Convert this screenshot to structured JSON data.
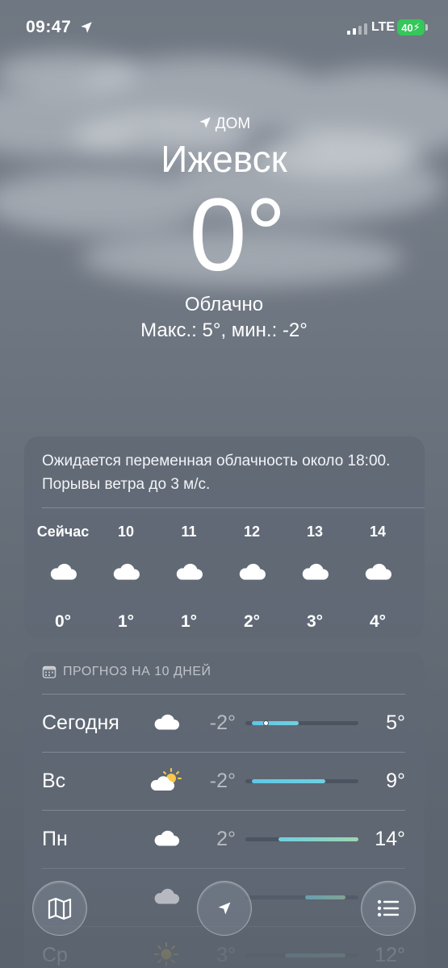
{
  "status_bar": {
    "time": "09:47",
    "network": "LTE",
    "battery": "40",
    "colors": {
      "battery": "#34c759"
    }
  },
  "header": {
    "home_label": "ДОМ",
    "city": "Ижевск",
    "temperature": "0°",
    "condition": "Облачно",
    "range": "Макс.: 5°, мин.: -2°"
  },
  "hourly": {
    "summary": "Ожидается переменная облачность около 18:00. Порывы ветра до 3 м/с.",
    "items": [
      {
        "hour": "Сейчас",
        "icon": "cloud-icon",
        "temp": "0°"
      },
      {
        "hour": "10",
        "icon": "cloud-icon",
        "temp": "1°"
      },
      {
        "hour": "11",
        "icon": "cloud-icon",
        "temp": "1°"
      },
      {
        "hour": "12",
        "icon": "cloud-icon",
        "temp": "2°"
      },
      {
        "hour": "13",
        "icon": "cloud-icon",
        "temp": "3°"
      },
      {
        "hour": "14",
        "icon": "cloud-icon",
        "temp": "4°"
      }
    ]
  },
  "daily": {
    "title": "ПРОГНОЗ НА 10 ДНЕЙ",
    "range_scale": [
      -3,
      14
    ],
    "days": [
      {
        "name": "Сегодня",
        "icon": "cloud-icon",
        "low": "-2°",
        "high": "5°",
        "low_value": -2,
        "high_value": 5,
        "current_value": 0
      },
      {
        "name": "Вс",
        "icon": "sun-cloud-icon",
        "low": "-2°",
        "high": "9°",
        "low_value": -2,
        "high_value": 9
      },
      {
        "name": "Пн",
        "icon": "cloud-icon",
        "low": "2°",
        "high": "14°",
        "low_value": 2,
        "high_value": 14
      },
      {
        "name": "",
        "icon": "cloud-icon",
        "low": "",
        "high": "",
        "low_value": 6,
        "high_value": 12
      },
      {
        "name": "Ср",
        "icon": "sun-icon",
        "low": "3°",
        "high": "12°",
        "low_value": 3,
        "high_value": 12
      }
    ]
  },
  "bottom_bar": {
    "map": "map-icon",
    "location": "location-arrow-icon",
    "list": "list-icon"
  }
}
